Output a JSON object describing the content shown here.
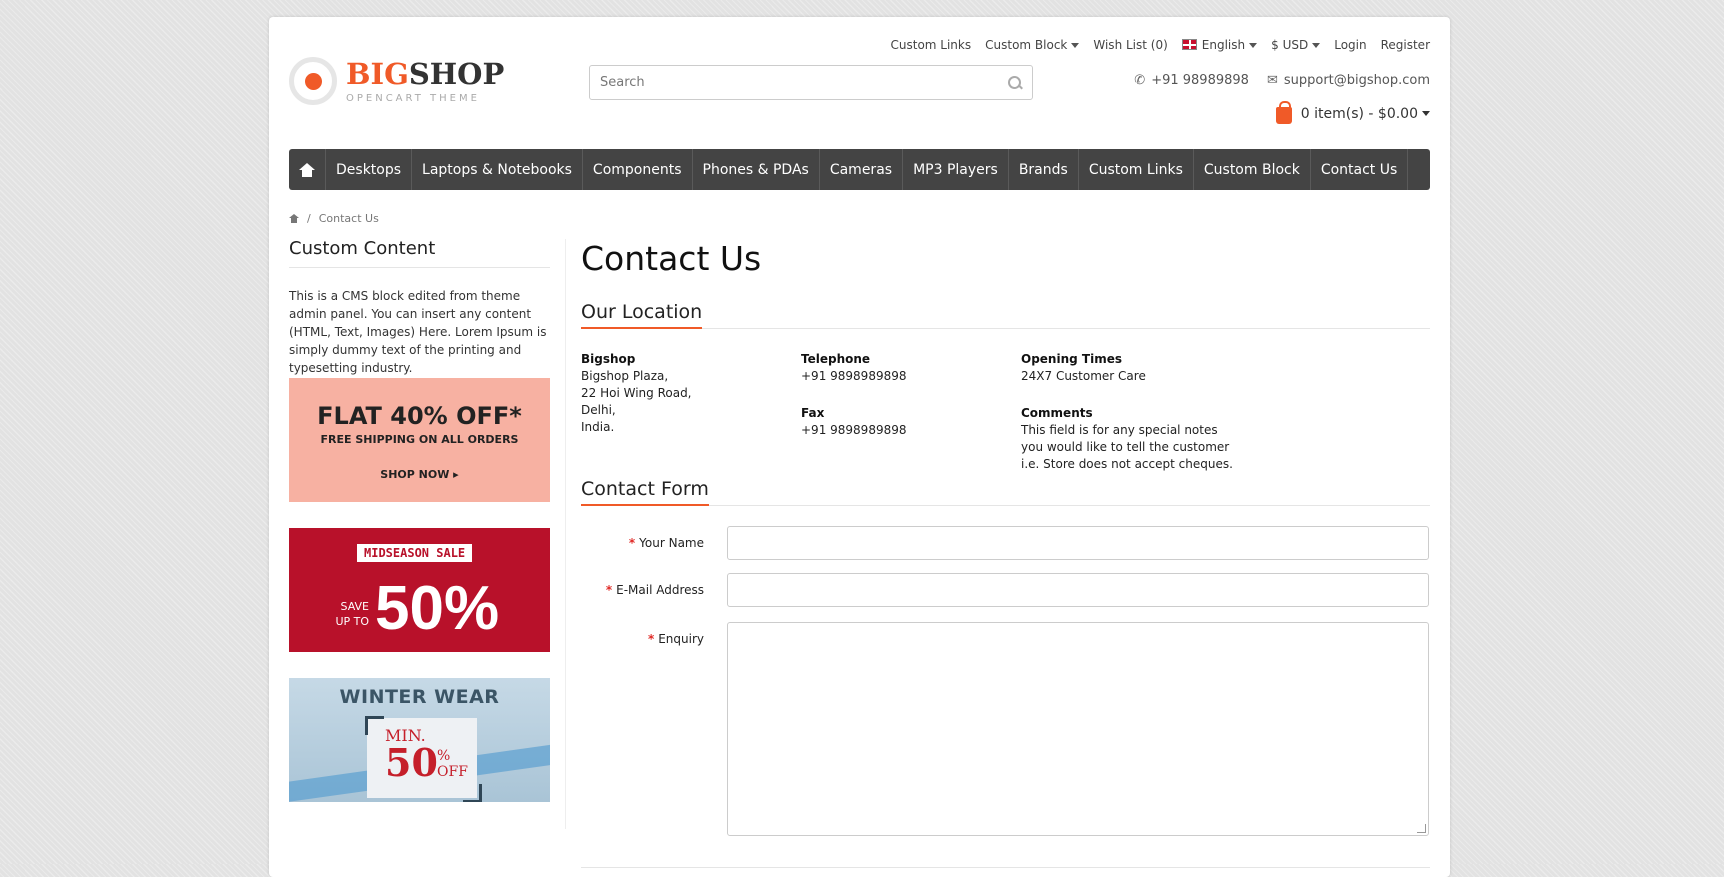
{
  "top_links": {
    "custom_links": "Custom Links",
    "custom_block": "Custom Block",
    "wish_list": "Wish List (0)",
    "language": "English",
    "currency": "$ USD",
    "login": "Login",
    "register": "Register"
  },
  "logo": {
    "big": "BIG",
    "shop": "SHOP",
    "subtitle": "OPENCART THEME"
  },
  "search": {
    "placeholder": "Search"
  },
  "contact": {
    "phone": "+91 98989898",
    "email": "support@bigshop.com"
  },
  "cart": {
    "summary": "0 item(s) - $0.00"
  },
  "nav": {
    "items": [
      "Desktops",
      "Laptops & Notebooks",
      "Components",
      "Phones & PDAs",
      "Cameras",
      "MP3 Players",
      "Brands",
      "Custom Links",
      "Custom Block",
      "Contact Us"
    ]
  },
  "breadcrumb": {
    "separator": "/",
    "current": "Contact Us"
  },
  "sidebar": {
    "title": "Custom Content",
    "text": "This is a CMS block edited from theme admin panel. You can insert any content (HTML, Text, Images) Here. Lorem Ipsum is simply dummy text of the printing and typesetting industry.",
    "banner1": {
      "headline": "FLAT 40% OFF*",
      "sub": "FREE SHIPPING ON ALL ORDERS",
      "cta": "SHOP NOW ▸"
    },
    "banner2": {
      "tag": "MIDSEASON SALE",
      "save": "SAVE UP TO",
      "percent": "50%"
    },
    "banner3": {
      "title": "WINTER WEAR",
      "min": "MIN.",
      "value": "50",
      "pct": "%",
      "off": "OFF"
    }
  },
  "main": {
    "title": "Contact Us",
    "location_title": "Our Location",
    "store_name": "Bigshop",
    "address": [
      "Bigshop Plaza,",
      "22 Hoi Wing Road,",
      "Delhi,",
      "India."
    ],
    "telephone_label": "Telephone",
    "telephone": "+91 9898989898",
    "fax_label": "Fax",
    "fax": "+91 9898989898",
    "opening_label": "Opening Times",
    "opening": "24X7 Customer Care",
    "comments_label": "Comments",
    "comments": [
      "This field is for any special notes",
      "you would like to tell the customer",
      "i.e. Store does not accept cheques."
    ],
    "form_title": "Contact Form",
    "form": {
      "required_mark": "*",
      "name_label": "Your Name",
      "email_label": "E-Mail Address",
      "enquiry_label": "Enquiry"
    }
  },
  "colors": {
    "accent": "#f05a28",
    "nav_bg": "#444444",
    "required": "#e02b27"
  }
}
